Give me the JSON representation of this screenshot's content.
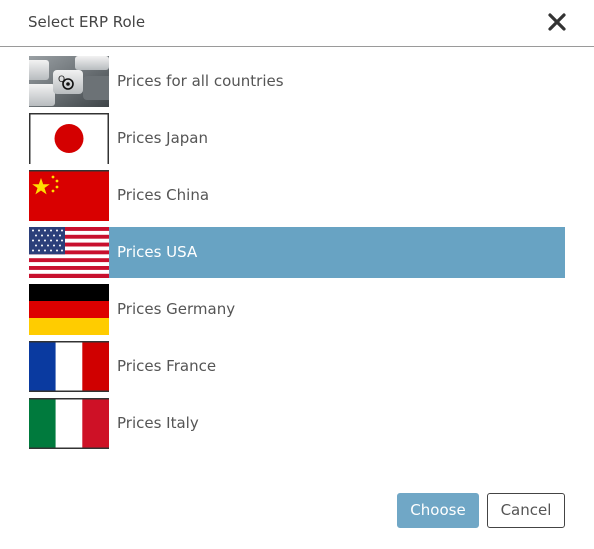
{
  "dialog": {
    "title": "Select ERP Role",
    "close_icon": "close-icon"
  },
  "roles": [
    {
      "label": "Prices for all countries",
      "icon": "keyboard-image",
      "selected": false
    },
    {
      "label": "Prices Japan",
      "icon": "japan-flag-icon",
      "selected": false
    },
    {
      "label": "Prices China",
      "icon": "china-flag-icon",
      "selected": false
    },
    {
      "label": "Prices USA",
      "icon": "usa-flag-icon",
      "selected": true
    },
    {
      "label": "Prices Germany",
      "icon": "germany-flag-icon",
      "selected": false
    },
    {
      "label": "Prices France",
      "icon": "france-flag-icon",
      "selected": false
    },
    {
      "label": "Prices Italy",
      "icon": "italy-flag-icon",
      "selected": false
    }
  ],
  "buttons": {
    "choose_label": "Choose",
    "cancel_label": "Cancel"
  },
  "colors": {
    "selected_row": "#68a3c3",
    "primary_button": "#70a7c6"
  }
}
